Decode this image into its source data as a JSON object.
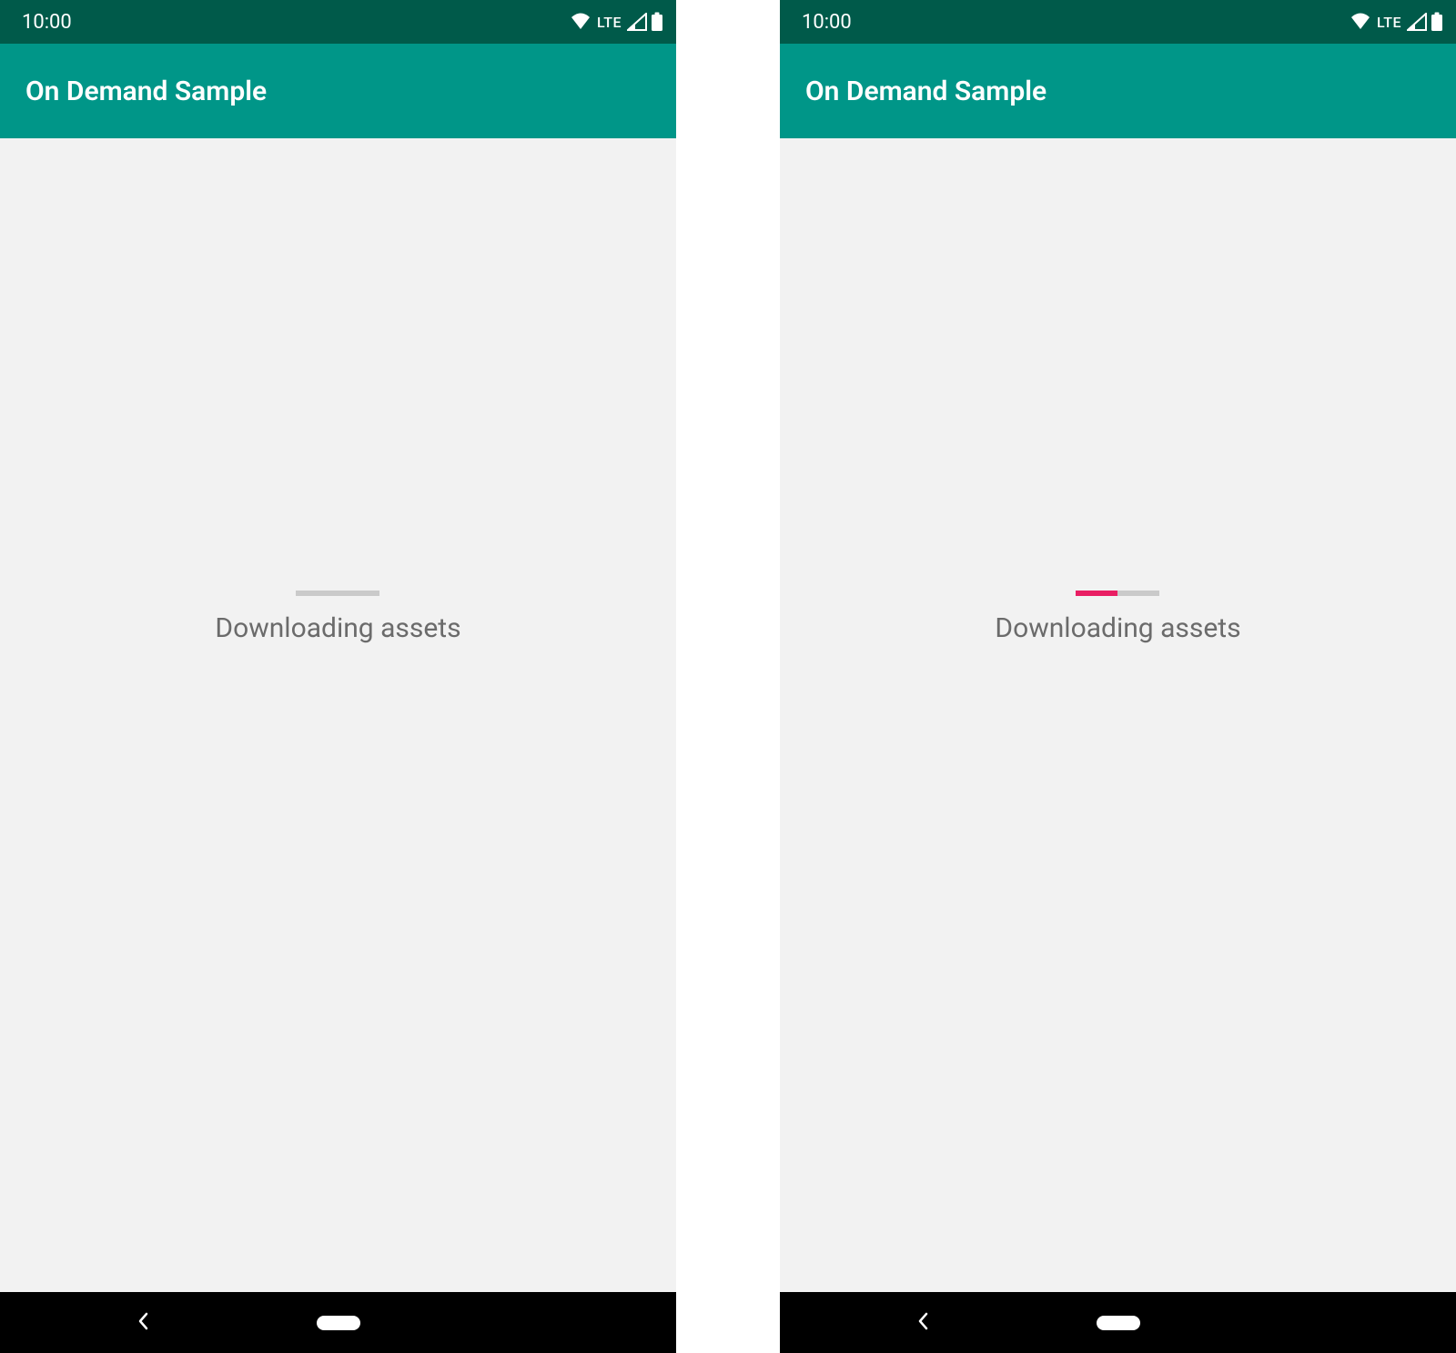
{
  "screens": [
    {
      "status": {
        "time": "10:00",
        "network_label": "LTE"
      },
      "appbar": {
        "title": "On Demand Sample"
      },
      "content": {
        "loading_label": "Downloading assets",
        "progress_percent": 0
      },
      "colors": {
        "status_bg": "#005a4a",
        "appbar_bg": "#009688",
        "accent": "#e91e63"
      }
    },
    {
      "status": {
        "time": "10:00",
        "network_label": "LTE"
      },
      "appbar": {
        "title": "On Demand Sample"
      },
      "content": {
        "loading_label": "Downloading assets",
        "progress_percent": 50
      },
      "colors": {
        "status_bg": "#005a4a",
        "appbar_bg": "#009688",
        "accent": "#e91e63"
      }
    }
  ]
}
